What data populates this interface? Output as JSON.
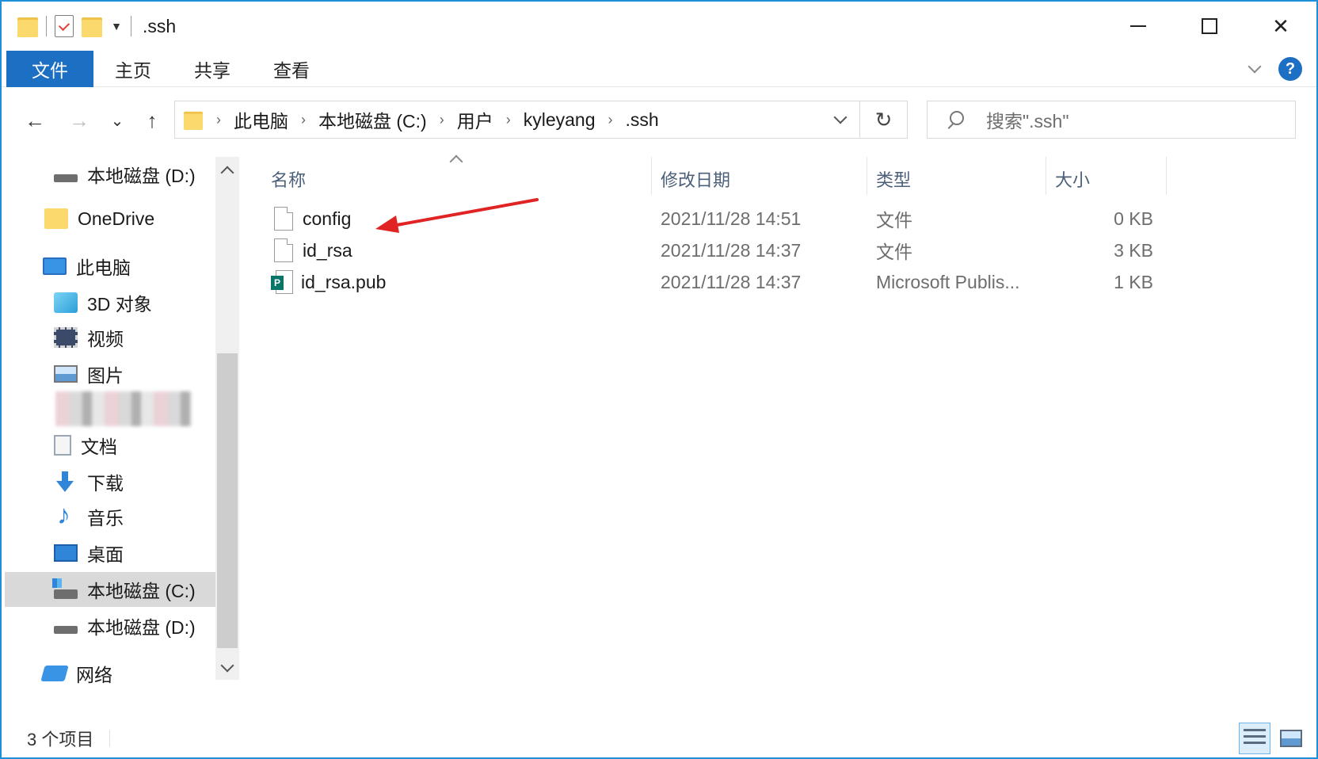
{
  "window": {
    "title": ".ssh"
  },
  "ribbon": {
    "tabs": [
      "文件",
      "主页",
      "共享",
      "查看"
    ],
    "help": "?"
  },
  "navbar": {
    "back": "←",
    "forward": "→",
    "recent": "⌄",
    "up": "↑",
    "breadcrumb": [
      "此电脑",
      "本地磁盘 (C:)",
      "用户",
      "kyleyang",
      ".ssh"
    ],
    "refresh": "↻",
    "search_placeholder": "搜索\".ssh\""
  },
  "sidebar": {
    "items": [
      {
        "label": "本地磁盘 (D:)",
        "icon": "drive-icon"
      },
      {
        "label": "OneDrive",
        "icon": "onedrive-folder-icon"
      },
      {
        "label": "此电脑",
        "icon": "this-pc-icon"
      },
      {
        "label": "3D 对象",
        "icon": "3d-objects-icon"
      },
      {
        "label": "视频",
        "icon": "videos-icon"
      },
      {
        "label": "图片",
        "icon": "pictures-icon"
      },
      {
        "label": "文档",
        "icon": "documents-icon"
      },
      {
        "label": "下载",
        "icon": "downloads-icon"
      },
      {
        "label": "音乐",
        "icon": "music-icon"
      },
      {
        "label": "桌面",
        "icon": "desktop-icon"
      },
      {
        "label": "本地磁盘 (C:)",
        "icon": "system-drive-icon",
        "selected": true
      },
      {
        "label": "本地磁盘 (D:)",
        "icon": "drive-icon"
      },
      {
        "label": "网络",
        "icon": "network-icon"
      }
    ]
  },
  "columns": {
    "name": "名称",
    "modified": "修改日期",
    "type": "类型",
    "size": "大小"
  },
  "files": [
    {
      "name": "config",
      "modified": "2021/11/28 14:51",
      "type": "文件",
      "size": "0 KB",
      "icon": "file-icon"
    },
    {
      "name": "id_rsa",
      "modified": "2021/11/28 14:37",
      "type": "文件",
      "size": "3 KB",
      "icon": "file-icon"
    },
    {
      "name": "id_rsa.pub",
      "modified": "2021/11/28 14:37",
      "type": "Microsoft Publis...",
      "size": "1 KB",
      "icon": "publisher-file-icon"
    }
  ],
  "status": {
    "item_count": "3 个项目"
  },
  "colors": {
    "accent": "#1d6fc4",
    "window_border": "#1e90d8",
    "annotation_arrow": "#e02424"
  }
}
